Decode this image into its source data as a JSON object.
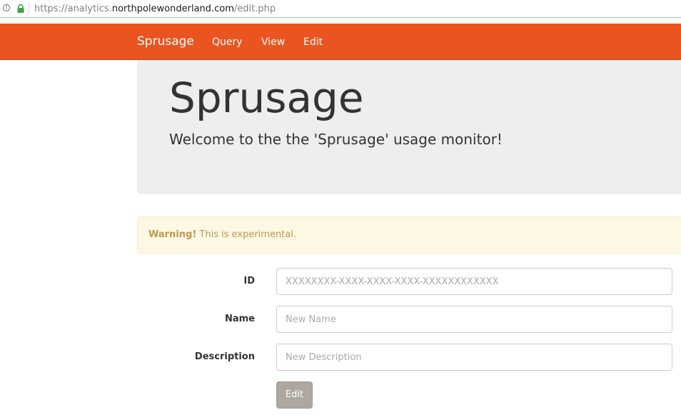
{
  "browser": {
    "url_prefix": "https://analytics.",
    "url_host": "northpolewonderland.com",
    "url_path": "/edit.php",
    "info_icon": "info-icon",
    "lock_icon": "lock-icon",
    "lock_color": "#43a047"
  },
  "navbar": {
    "brand": "Sprusage",
    "links": [
      "Query",
      "View",
      "Edit"
    ],
    "color": "#e95420"
  },
  "jumbotron": {
    "title": "Sprusage",
    "subtitle": "Welcome to the the 'Sprusage' usage monitor!"
  },
  "alert": {
    "strong": "Warning!",
    "text": " This is experimental."
  },
  "form": {
    "id_label": "ID",
    "id_placeholder": "XXXXXXXX-XXXX-XXXX-XXXX-XXXXXXXXXXXX",
    "name_label": "Name",
    "name_placeholder": "New Name",
    "description_label": "Description",
    "description_placeholder": "New Description",
    "submit_label": "Edit"
  }
}
